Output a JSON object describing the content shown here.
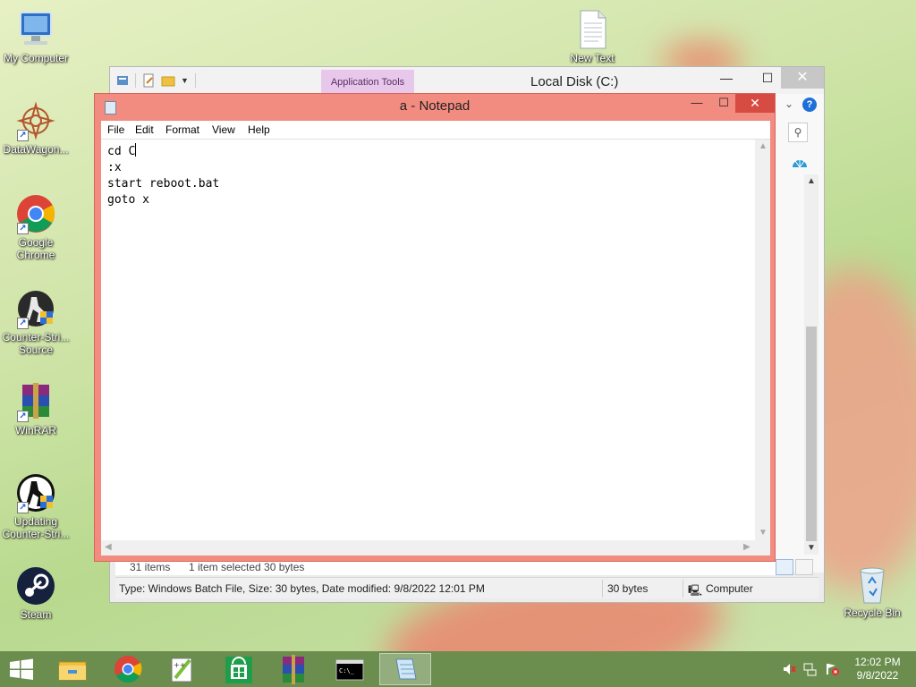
{
  "desktop": {
    "icons": [
      {
        "label": "My Computer"
      },
      {
        "label": "DataWagon..."
      },
      {
        "label": "Google Chrome"
      },
      {
        "label": "Counter-Stri... Source"
      },
      {
        "label": "WinRAR"
      },
      {
        "label": "Updating Counter-Stri..."
      },
      {
        "label": "Steam"
      },
      {
        "label": "New Text"
      },
      {
        "label": "Recycle Bin"
      }
    ]
  },
  "explorer": {
    "title": "Local Disk (C:)",
    "ribbon_context_tab": "Application Tools",
    "help_label": "?",
    "status": {
      "items_count": "31 items",
      "selection": "1 item selected  30 bytes",
      "details": "Type: Windows Batch File, Size: 30 bytes, Date modified: 9/8/2022 12:01 PM",
      "size": "30 bytes",
      "location": "Computer"
    }
  },
  "notepad": {
    "title": "a - Notepad",
    "menu": [
      "File",
      "Edit",
      "Format",
      "View",
      "Help"
    ],
    "lines": [
      "cd C",
      ":x",
      "start reboot.bat",
      "goto x"
    ]
  },
  "taskbar": {
    "clock_time": "12:02 PM",
    "clock_date": "9/8/2022"
  },
  "colors": {
    "notepad_frame": "#f28b80",
    "close_button": "#d64c42",
    "taskbar": "#6b8e4e"
  }
}
